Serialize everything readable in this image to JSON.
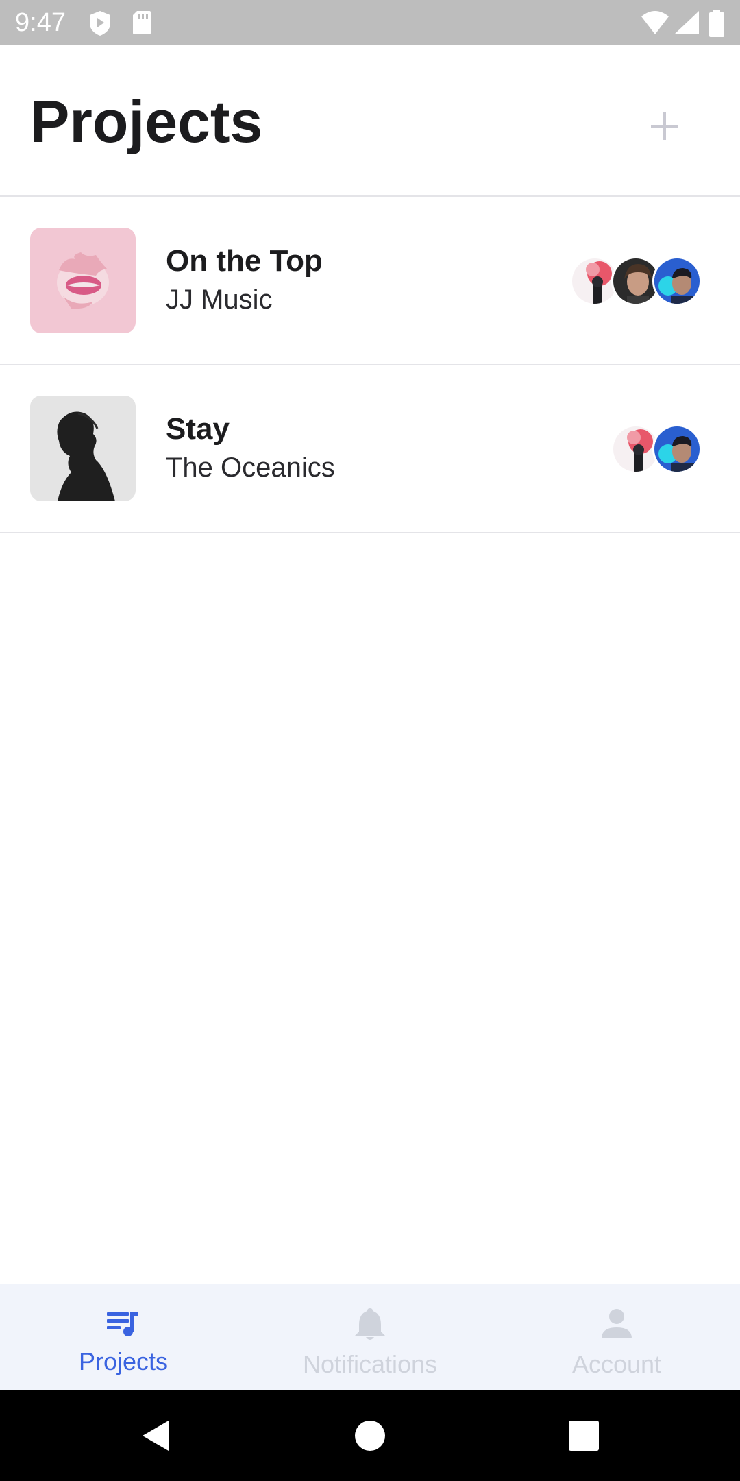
{
  "status_bar": {
    "time": "9:47",
    "icons": [
      "shield-icon",
      "sd-card-icon",
      "wifi-icon",
      "signal-icon",
      "battery-icon"
    ]
  },
  "header": {
    "title": "Projects",
    "add_icon": "plus-icon"
  },
  "projects": [
    {
      "title": "On the Top",
      "artist": "JJ Music",
      "cover": "pink-lips-cover",
      "collaborators": [
        "avatar-red-smoke",
        "avatar-woman",
        "avatar-neon-man"
      ]
    },
    {
      "title": "Stay",
      "artist": "The Oceanics",
      "cover": "silhouette-cover",
      "collaborators": [
        "avatar-red-smoke",
        "avatar-neon-man"
      ]
    }
  ],
  "bottom_nav": {
    "items": [
      {
        "label": "Projects",
        "icon": "music-queue-icon",
        "active": true
      },
      {
        "label": "Notifications",
        "icon": "bell-icon",
        "active": false
      },
      {
        "label": "Account",
        "icon": "person-icon",
        "active": false
      }
    ]
  },
  "colors": {
    "accent": "#3a63e0",
    "inactive": "#cfd3dc",
    "nav_background": "#f1f4fb",
    "divider": "#e4e4e8"
  }
}
